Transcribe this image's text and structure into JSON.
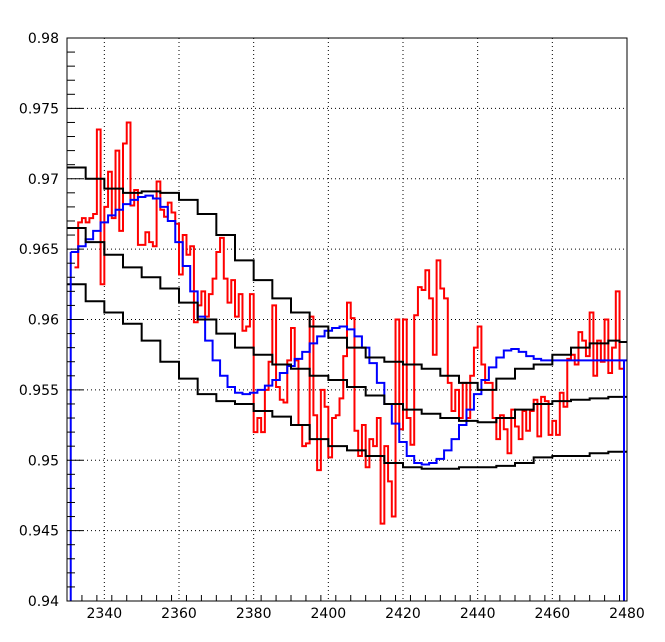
{
  "chart_data": {
    "type": "line",
    "title": "",
    "xlabel": "",
    "ylabel": "",
    "xlim": [
      2330,
      2480
    ],
    "ylim": [
      0.94,
      0.98
    ],
    "grid": true,
    "x_ticks": [
      2340,
      2360,
      2380,
      2400,
      2420,
      2440,
      2460,
      2480
    ],
    "x_tick_labels": [
      "2340",
      "2360",
      "2380",
      "2400",
      "2420",
      "2440",
      "2460",
      "2480"
    ],
    "y_ticks": [
      0.94,
      0.945,
      0.95,
      0.955,
      0.96,
      0.965,
      0.97,
      0.975,
      0.98
    ],
    "y_tick_labels": [
      "0.94",
      "0.945",
      "0.95",
      "0.955",
      "0.96",
      "0.965",
      "0.97",
      "0.975",
      "0.98"
    ],
    "step_style": true,
    "series": [
      {
        "color": "#ff0000",
        "x": [
          2332,
          2333,
          2334,
          2335,
          2336,
          2337,
          2338,
          2339,
          2340,
          2341,
          2342,
          2343,
          2344,
          2345,
          2346,
          2347,
          2348,
          2349,
          2350,
          2351,
          2352,
          2353,
          2354,
          2355,
          2356,
          2357,
          2358,
          2359,
          2360,
          2361,
          2362,
          2363,
          2364,
          2365,
          2366,
          2367,
          2368,
          2369,
          2370,
          2371,
          2372,
          2373,
          2374,
          2375,
          2376,
          2377,
          2378,
          2379,
          2380,
          2381,
          2382,
          2383,
          2384,
          2385,
          2386,
          2387,
          2388,
          2389,
          2390,
          2391,
          2392,
          2393,
          2394,
          2395,
          2396,
          2397,
          2398,
          2399,
          2400,
          2401,
          2402,
          2403,
          2404,
          2405,
          2406,
          2407,
          2408,
          2409,
          2410,
          2411,
          2412,
          2413,
          2414,
          2415,
          2416,
          2417,
          2418,
          2419,
          2420,
          2421,
          2422,
          2423,
          2424,
          2425,
          2426,
          2427,
          2428,
          2429,
          2430,
          2431,
          2432,
          2433,
          2434,
          2435,
          2436,
          2437,
          2438,
          2439,
          2440,
          2441,
          2442,
          2443,
          2444,
          2445,
          2446,
          2447,
          2448,
          2449,
          2450,
          2451,
          2452,
          2453,
          2454,
          2455,
          2456,
          2457,
          2458,
          2459,
          2460,
          2461,
          2462,
          2463,
          2464,
          2465,
          2466,
          2467,
          2468,
          2469,
          2470,
          2471,
          2472,
          2473,
          2474,
          2475,
          2476,
          2477,
          2478
        ],
        "y": [
          0.9637,
          0.9669,
          0.9672,
          0.9669,
          0.9672,
          0.9675,
          0.9735,
          0.9625,
          0.968,
          0.9705,
          0.9672,
          0.972,
          0.9663,
          0.9725,
          0.974,
          0.9681,
          0.9692,
          0.9653,
          0.9653,
          0.9662,
          0.9655,
          0.9652,
          0.9698,
          0.9678,
          0.9673,
          0.9683,
          0.9676,
          0.9668,
          0.9632,
          0.966,
          0.9646,
          0.9652,
          0.9598,
          0.961,
          0.962,
          0.9602,
          0.9618,
          0.9629,
          0.9648,
          0.9658,
          0.9629,
          0.9612,
          0.9628,
          0.9602,
          0.9618,
          0.9592,
          0.9595,
          0.9618,
          0.952,
          0.953,
          0.952,
          0.955,
          0.957,
          0.961,
          0.9552,
          0.9543,
          0.9541,
          0.9571,
          0.9594,
          0.9571,
          0.9525,
          0.951,
          0.9512,
          0.9602,
          0.9532,
          0.9493,
          0.955,
          0.9538,
          0.9502,
          0.953,
          0.9532,
          0.9544,
          0.9574,
          0.9612,
          0.9601,
          0.9521,
          0.9503,
          0.9525,
          0.9495,
          0.9515,
          0.951,
          0.953,
          0.9455,
          0.951,
          0.9485,
          0.946,
          0.96,
          0.9522,
          0.96,
          0.953,
          0.9511,
          0.9603,
          0.9623,
          0.9621,
          0.9635,
          0.9615,
          0.9575,
          0.9642,
          0.9622,
          0.9615,
          0.9555,
          0.9535,
          0.955,
          0.953,
          0.9555,
          0.953,
          0.956,
          0.958,
          0.9595,
          0.9568,
          0.9555,
          0.9555,
          0.953,
          0.9515,
          0.9532,
          0.9522,
          0.9505,
          0.9536,
          0.9524,
          0.9515,
          0.9535,
          0.9521,
          0.9535,
          0.9543,
          0.9517,
          0.9545,
          0.9542,
          0.9518,
          0.9528,
          0.9518,
          0.9548,
          0.9538,
          0.9572,
          0.9575,
          0.9568,
          0.9591,
          0.9585,
          0.9574,
          0.9605,
          0.956,
          0.9585,
          0.957,
          0.96,
          0.9562,
          0.958,
          0.962,
          0.9565
        ]
      },
      {
        "color": "#0000ff",
        "x": [
          2331,
          2333,
          2335,
          2337,
          2339,
          2341,
          2343,
          2345,
          2347,
          2349,
          2351,
          2353,
          2355,
          2357,
          2359,
          2361,
          2363,
          2365,
          2367,
          2369,
          2371,
          2373,
          2375,
          2377,
          2379,
          2381,
          2383,
          2385,
          2387,
          2389,
          2391,
          2393,
          2395,
          2397,
          2399,
          2401,
          2403,
          2405,
          2407,
          2409,
          2411,
          2413,
          2415,
          2417,
          2419,
          2421,
          2423,
          2425,
          2427,
          2429,
          2431,
          2433,
          2435,
          2437,
          2439,
          2441,
          2443,
          2445,
          2447,
          2449,
          2451,
          2453,
          2455,
          2457,
          2459,
          2461,
          2463,
          2465,
          2467,
          2469,
          2471,
          2473,
          2475,
          2477,
          2478
        ],
        "y": [
          0.9648,
          0.9652,
          0.9657,
          0.9663,
          0.9669,
          0.9674,
          0.9678,
          0.9682,
          0.9685,
          0.9687,
          0.9688,
          0.9686,
          0.968,
          0.967,
          0.9655,
          0.9638,
          0.962,
          0.9602,
          0.9585,
          0.9571,
          0.956,
          0.9552,
          0.9548,
          0.9547,
          0.9548,
          0.955,
          0.9553,
          0.9557,
          0.9562,
          0.9567,
          0.9572,
          0.9577,
          0.9583,
          0.9588,
          0.9592,
          0.9594,
          0.9595,
          0.9593,
          0.9588,
          0.958,
          0.9569,
          0.9555,
          0.954,
          0.9526,
          0.9513,
          0.9503,
          0.9498,
          0.9497,
          0.9498,
          0.9501,
          0.9507,
          0.9515,
          0.9525,
          0.9536,
          0.9547,
          0.9557,
          0.9566,
          0.9573,
          0.9578,
          0.9579,
          0.9577,
          0.9574,
          0.9572,
          0.9571,
          0.9571,
          0.9571,
          0.9571,
          0.9571,
          0.9571,
          0.9571,
          0.9571,
          0.9571,
          0.9571,
          0.9571,
          0.9571
        ]
      },
      {
        "color": "#000000",
        "x": [
          2330,
          2335,
          2340,
          2345,
          2350,
          2355,
          2360,
          2365,
          2370,
          2375,
          2380,
          2385,
          2390,
          2395,
          2400,
          2405,
          2410,
          2415,
          2420,
          2425,
          2430,
          2435,
          2440,
          2445,
          2450,
          2455,
          2460,
          2465,
          2470,
          2475,
          2478
        ],
        "y": [
          0.9708,
          0.97,
          0.9693,
          0.969,
          0.9691,
          0.969,
          0.9685,
          0.9675,
          0.966,
          0.9642,
          0.9628,
          0.9615,
          0.9605,
          0.9595,
          0.9587,
          0.958,
          0.9573,
          0.957,
          0.9568,
          0.9565,
          0.956,
          0.9555,
          0.955,
          0.9558,
          0.9565,
          0.9568,
          0.9575,
          0.958,
          0.9583,
          0.9585,
          0.9584
        ]
      },
      {
        "color": "#000000",
        "x": [
          2330,
          2335,
          2340,
          2345,
          2350,
          2355,
          2360,
          2365,
          2370,
          2375,
          2380,
          2385,
          2390,
          2395,
          2400,
          2405,
          2410,
          2415,
          2420,
          2425,
          2430,
          2435,
          2440,
          2445,
          2450,
          2455,
          2460,
          2465,
          2470,
          2475,
          2478
        ],
        "y": [
          0.9665,
          0.9655,
          0.9646,
          0.9637,
          0.963,
          0.9622,
          0.9612,
          0.96,
          0.959,
          0.958,
          0.9575,
          0.9568,
          0.9565,
          0.956,
          0.9557,
          0.9552,
          0.9546,
          0.954,
          0.9536,
          0.9533,
          0.953,
          0.9528,
          0.9527,
          0.953,
          0.9536,
          0.954,
          0.9542,
          0.9543,
          0.9544,
          0.9545,
          0.9545
        ]
      },
      {
        "color": "#000000",
        "x": [
          2330,
          2335,
          2340,
          2345,
          2350,
          2355,
          2360,
          2365,
          2370,
          2375,
          2380,
          2385,
          2390,
          2395,
          2400,
          2405,
          2410,
          2415,
          2420,
          2425,
          2430,
          2435,
          2440,
          2445,
          2450,
          2455,
          2460,
          2465,
          2470,
          2475,
          2478
        ],
        "y": [
          0.9625,
          0.9613,
          0.9605,
          0.9597,
          0.9585,
          0.957,
          0.9558,
          0.9547,
          0.9542,
          0.954,
          0.9535,
          0.9531,
          0.9525,
          0.9515,
          0.951,
          0.9507,
          0.9503,
          0.9498,
          0.9495,
          0.9494,
          0.9494,
          0.9495,
          0.9495,
          0.9496,
          0.9498,
          0.9502,
          0.9503,
          0.9503,
          0.9505,
          0.9506,
          0.9506
        ]
      }
    ]
  }
}
